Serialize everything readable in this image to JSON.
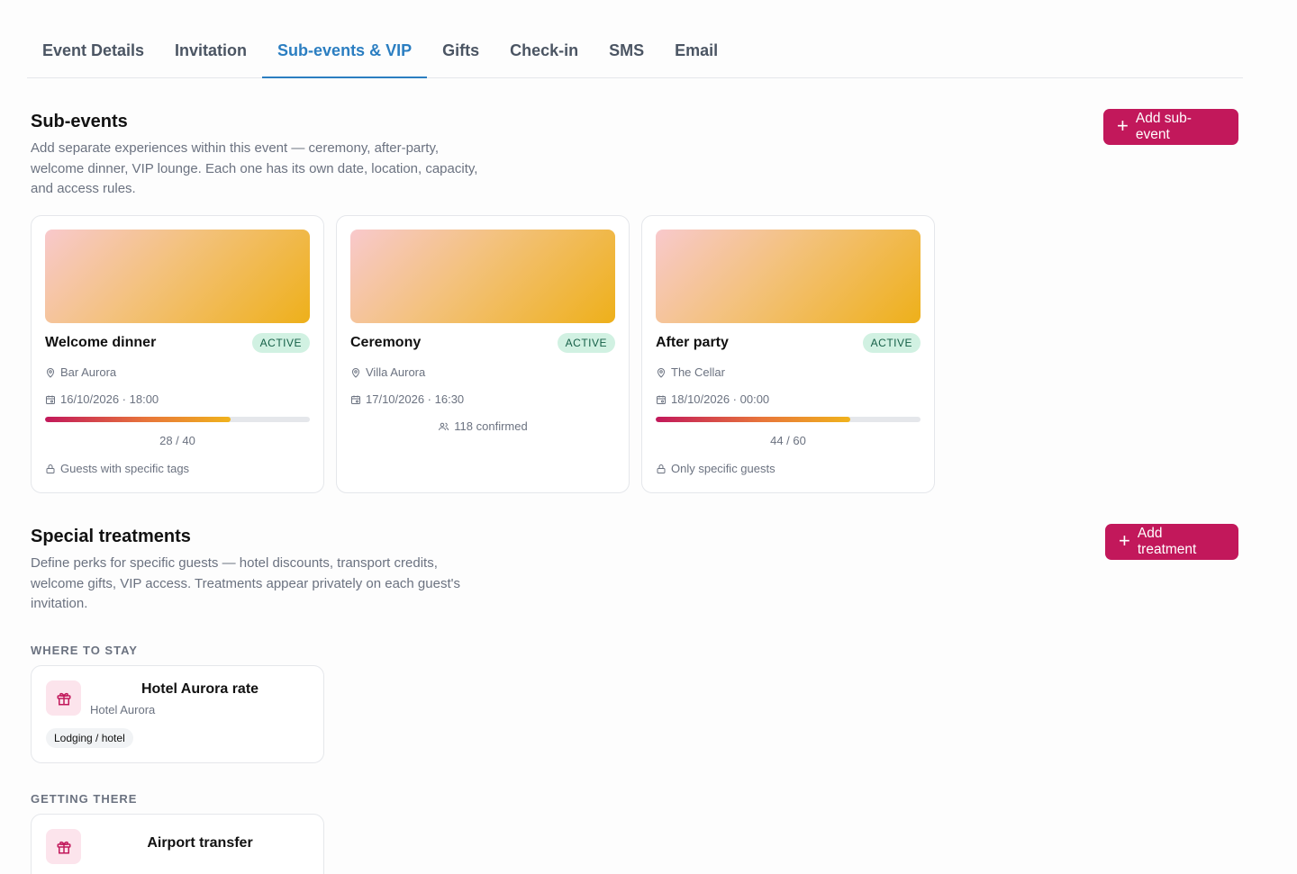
{
  "tabs": [
    {
      "label": "Event Details"
    },
    {
      "label": "Invitation"
    },
    {
      "label": "Sub-events & VIP",
      "active": true
    },
    {
      "label": "Gifts"
    },
    {
      "label": "Check-in"
    },
    {
      "label": "SMS"
    },
    {
      "label": "Email"
    }
  ],
  "subevents": {
    "title": "Sub-events",
    "description": "Add separate experiences within this event — ceremony, after-party, welcome dinner, VIP lounge. Each one has its own date, location, capacity, and access rules.",
    "add_button": "Add sub-event",
    "items": [
      {
        "title": "Welcome dinner",
        "status": "ACTIVE",
        "location": "Bar Aurora",
        "datetime": "16/10/2026 · 18:00",
        "capacity_label": "28 / 40",
        "fill_fraction": 0.7,
        "access": "Guests with specific tags"
      },
      {
        "title": "Ceremony",
        "status": "ACTIVE",
        "location": "Villa Aurora",
        "datetime": "17/10/2026 · 16:30",
        "confirmed": "118 confirmed"
      },
      {
        "title": "After party",
        "status": "ACTIVE",
        "location": "The Cellar",
        "datetime": "18/10/2026 · 00:00",
        "capacity_label": "44 / 60",
        "fill_fraction": 0.733,
        "access": "Only specific guests"
      }
    ]
  },
  "treatments": {
    "title": "Special treatments",
    "description": "Define perks for specific guests — hotel discounts, transport credits, welcome gifts, VIP access. Treatments appear privately on each guest's invitation.",
    "add_button": "Add treatment",
    "groups": [
      {
        "label": "WHERE TO STAY",
        "items": [
          {
            "title": "Hotel Aurora rate",
            "subtitle": "Hotel Aurora",
            "tag": "Lodging / hotel"
          }
        ]
      },
      {
        "label": "GETTING THERE",
        "items": [
          {
            "title": "Airport transfer"
          }
        ]
      }
    ]
  },
  "colors": {
    "accent_tab": "#2b7ec1",
    "primary_button": "#c2185b",
    "badge_bg": "#d1f1e2",
    "badge_text": "#166048"
  },
  "icons": {
    "location": "map-pin-icon",
    "date": "calendar-icon",
    "lock": "lock-icon",
    "users": "users-icon",
    "gift": "gift-icon",
    "plus": "plus-icon"
  }
}
